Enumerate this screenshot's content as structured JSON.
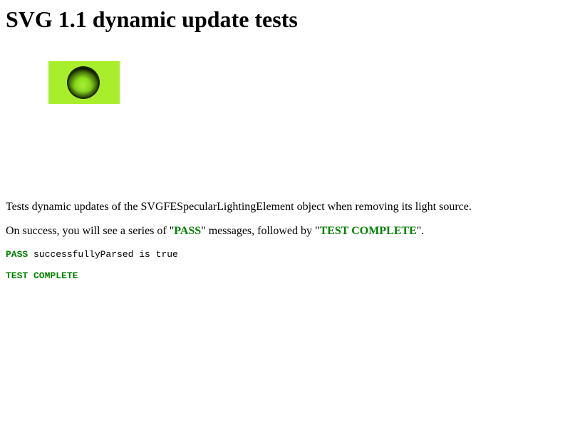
{
  "title": "SVG 1.1 dynamic update tests",
  "figure": {
    "background_color": "#a8ee2a",
    "circle_color": "#8ee51c"
  },
  "description": "Tests dynamic updates of the SVGFESpecularLightingElement object when removing its light source.",
  "instructions": {
    "prefix": "On success, you will see a series of \"",
    "pass_word": "PASS",
    "middle": "\" messages, followed by \"",
    "complete_word": "TEST COMPLETE",
    "suffix": "\"."
  },
  "console": {
    "line1": {
      "status": "PASS",
      "message": " successfullyParsed is true"
    },
    "line2": {
      "status": "TEST COMPLETE"
    }
  },
  "colors": {
    "pass_green": "#008000"
  }
}
